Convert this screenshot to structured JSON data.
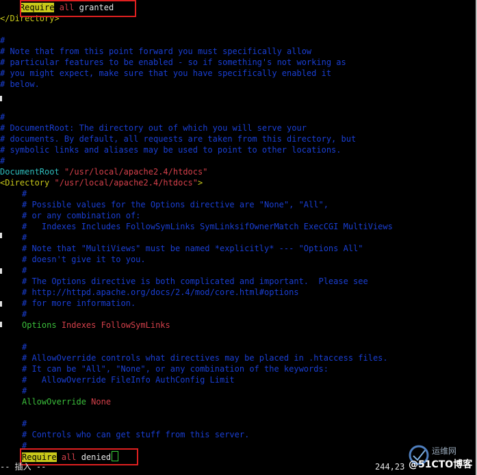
{
  "lines": {
    "l1_kw": "Require",
    "l1_a": "all",
    "l1_b": "granted",
    "l2": "</Directory>",
    "c_hash": "#",
    "c1": "# Note that from this point forward you must specifically allow",
    "c2": "# particular features to be enabled - so if something's not working as",
    "c3": "# you might expect, make sure that you have specifically enabled it",
    "c4": "# below.",
    "d1": "# DocumentRoot: The directory out of which you will serve your",
    "d2": "# documents. By default, all requests are taken from this directory, but",
    "d3": "# symbolic links and aliases may be used to point to other locations.",
    "docroot_dir": "DocumentRoot",
    "docroot_path": "\"/usr/local/apache2.4/htdocs\"",
    "dir_open": "<Directory",
    "dir_path": "\"/usr/local/apache2.4/htdocs\"",
    "dir_close": ">",
    "o1": "# Possible values for the Options directive are \"None\", \"All\",",
    "o2": "# or any combination of:",
    "o3": "#   Indexes Includes FollowSymLinks SymLinksifOwnerMatch ExecCGI MultiViews",
    "o4": "# Note that \"MultiViews\" must be named *explicitly* --- \"Options All\"",
    "o5": "# doesn't give it to you.",
    "o6": "# The Options directive is both complicated and important.  Please see",
    "o7": "# http://httpd.apache.org/docs/2.4/mod/core.html#options",
    "o8": "# for more information.",
    "options_dir": "Options",
    "options_val": "Indexes FollowSymLinks",
    "a1": "# AllowOverride controls what directives may be placed in .htaccess files.",
    "a2": "# It can be \"All\", \"None\", or any combination of the keywords:",
    "a3": "#   AllowOverride FileInfo AuthConfig Limit",
    "allow_dir": "AllowOverride",
    "allow_val": "None",
    "r1": "# Controls who can get stuff from this server.",
    "last_kw": "Require",
    "last_a": "all",
    "last_b": "denied"
  },
  "status": {
    "mode": "-- 插入 --",
    "position": "244,23"
  },
  "watermark": {
    "site": "运维网",
    "blog": "@51CTO博客"
  },
  "colors": {
    "comment": "#1a3fd4",
    "tag": "#c9c91a",
    "keyword": "#3bbf3b",
    "string": "#d4404a",
    "highlight_box": "#e02020"
  }
}
